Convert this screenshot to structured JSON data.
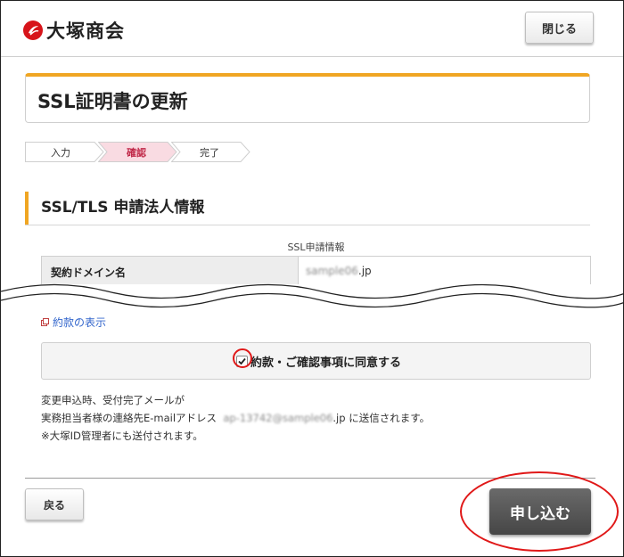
{
  "header": {
    "logo_text": "大塚商会",
    "close_label": "閉じる"
  },
  "page": {
    "title": "SSL証明書の更新"
  },
  "steps": [
    {
      "label": "入力",
      "state": "done"
    },
    {
      "label": "確認",
      "state": "current"
    },
    {
      "label": "完了",
      "state": "todo"
    }
  ],
  "section": {
    "heading": "SSL/TLS 申請法人情報",
    "caption": "SSL申請情報",
    "rows": [
      {
        "label": "契約ドメイン名",
        "value_blurred": "sample06",
        "value_suffix": ".jp"
      }
    ]
  },
  "terms": {
    "link_label": "約款の表示",
    "agree_label": "約款・ご確認事項に同意する",
    "agree_checked": true
  },
  "notes": {
    "line1": "変更申込時、受付完了メールが",
    "line2_prefix": "実務担当者様の連絡先E-mailアドレス",
    "line2_email_blurred": "ap-13742@sample06",
    "line2_email_suffix": ".jp",
    "line2_suffix": "に送信されます。",
    "line3": "※大塚ID管理者にも送付されます。"
  },
  "footer": {
    "back_label": "戻る",
    "submit_label": "申し込む"
  },
  "colors": {
    "accent": "#f0a623",
    "highlight_red": "#e01818",
    "link": "#3366cc",
    "brand_red": "#d7141a"
  }
}
